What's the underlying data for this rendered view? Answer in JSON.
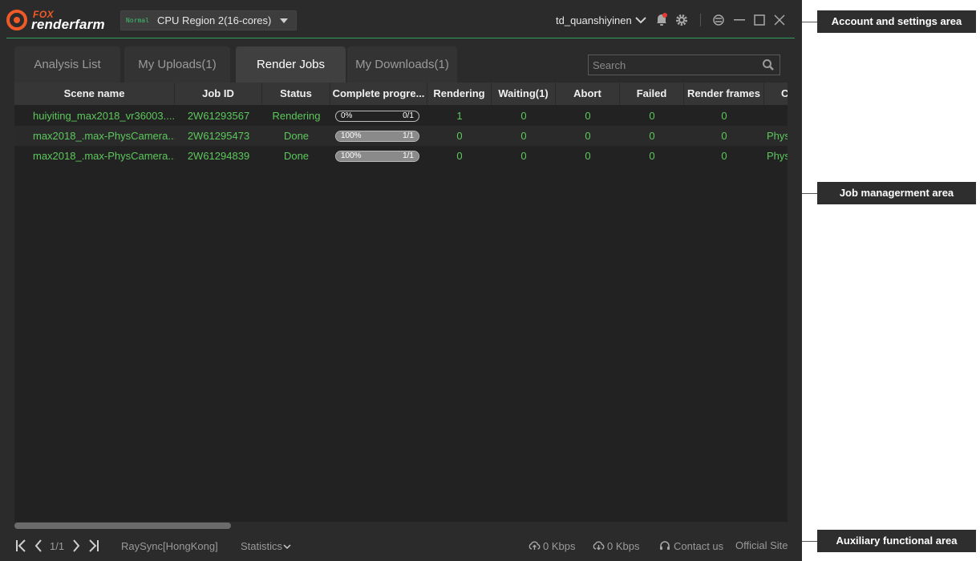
{
  "app": {
    "logo_top": "FOX",
    "logo_bottom": "renderfarm",
    "region_tag": "Normal",
    "region_label": "CPU Region 2(16-cores)",
    "account": "td_quanshiyinen"
  },
  "tabs": [
    {
      "label": "Analysis List",
      "active": false
    },
    {
      "label": "My Uploads(1)",
      "active": false
    },
    {
      "label": "Render Jobs",
      "active": true
    },
    {
      "label": "My Downloads(1)",
      "active": false
    }
  ],
  "search": {
    "placeholder": "Search"
  },
  "table": {
    "columns": [
      "Scene name",
      "Job ID",
      "Status",
      "Complete progre...",
      "Rendering",
      "Waiting(1)",
      "Abort",
      "Failed",
      "Render frames",
      "C"
    ],
    "rows": [
      {
        "scene": "huiyiting_max2018_vr36003....",
        "job_id": "2W61293567",
        "status": "Rendering",
        "progress_pct": 0,
        "progress_label": "0%",
        "progress_frames": "0/1",
        "rendering": "1",
        "waiting": "0",
        "abort": "0",
        "failed": "0",
        "render_frames": "0",
        "camera": ""
      },
      {
        "scene": "max2018_.max-PhysCamera...",
        "job_id": "2W61295473",
        "status": "Done",
        "progress_pct": 100,
        "progress_label": "100%",
        "progress_frames": "1/1",
        "rendering": "0",
        "waiting": "0",
        "abort": "0",
        "failed": "0",
        "render_frames": "0",
        "camera": "Phys"
      },
      {
        "scene": "max2018_.max-PhysCamera...",
        "job_id": "2W61294839",
        "status": "Done",
        "progress_pct": 100,
        "progress_label": "100%",
        "progress_frames": "1/1",
        "rendering": "0",
        "waiting": "0",
        "abort": "0",
        "failed": "0",
        "render_frames": "0",
        "camera": "Phys"
      }
    ]
  },
  "footer": {
    "page": "1/1",
    "raysync": "RaySync[HongKong]",
    "statistics": "Statistics",
    "upload_speed": "0 Kbps",
    "download_speed": "0 Kbps",
    "contact": "Contact us",
    "official_site": "Official Site"
  },
  "callouts": {
    "account_settings": "Account and settings area",
    "job_management": "Job managerment area",
    "auxiliary": "Auxiliary functional area"
  },
  "colors": {
    "accent_green": "#5cc85c",
    "brand_orange": "#f05a28",
    "notify_red": "#e53935",
    "app_bg": "#2b2b2b"
  }
}
